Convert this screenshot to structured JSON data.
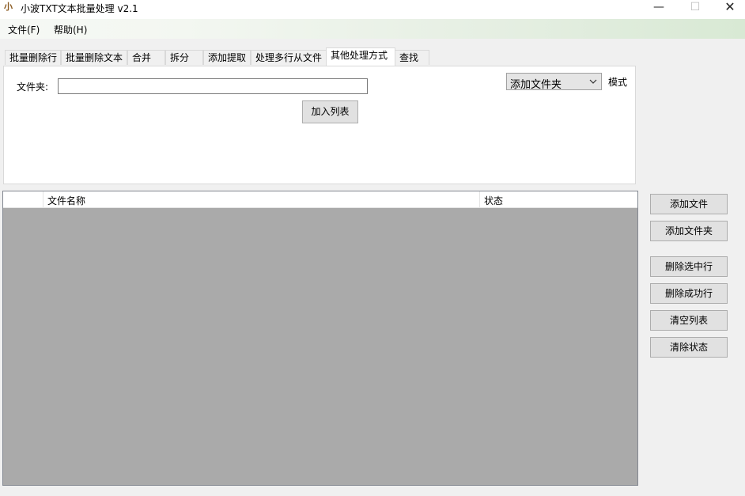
{
  "window": {
    "title": "小波TXT文本批量处理 v2.1",
    "icon": "小",
    "controls": {
      "minimize": "—",
      "maximize": "☐",
      "close": "✕"
    }
  },
  "menubar": {
    "items": [
      "文件(F)",
      "帮助(H)"
    ]
  },
  "tabs": {
    "items": [
      "批量删除行",
      "批量删除文本",
      "合并",
      "拆分",
      "添加提取",
      "处理多行从文件",
      "其他处理方式",
      "查找"
    ],
    "active": "其他处理方式"
  },
  "panel": {
    "folder_label": "文件夹:",
    "folder_value": "",
    "add_to_list_button": "加入列表",
    "mode_select_value": "添加文件夹",
    "mode_label": "模式"
  },
  "filelist": {
    "columns": [
      "",
      "文件名称",
      "状态"
    ],
    "rows": []
  },
  "side_buttons": {
    "add_file": "添加文件",
    "add_folder": "添加文件夹",
    "delete_selected": "删除选中行",
    "delete_success": "删除成功行",
    "clear_list": "清空列表",
    "clear_status": "清除状态"
  }
}
